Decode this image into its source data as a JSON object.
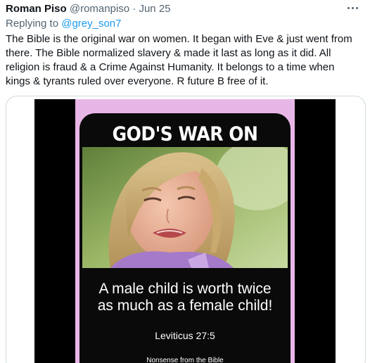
{
  "tweet": {
    "author_name": "Roman Piso",
    "author_handle": "@romanpiso",
    "separator": "·",
    "date": "Jun 25",
    "reply_prefix": "Replying to",
    "reply_to": "@grey_son7",
    "text": "The Bible is the original war on women. It began with Eve & just went from there. The Bible normalized slavery & made it last as long as it did. All religion is fraud & a Crime Against Humanity. It belongs to a time when kings & tyrants ruled over everyone. R future B free of it."
  },
  "media": {
    "title": "GOD'S WAR ON WOMEN",
    "caption_line1": "A male child is worth twice",
    "caption_line2": "as much as a female child!",
    "verse": "Leviticus 27:5",
    "source": "Nonsense from the Bible",
    "photo_icon": "crying-girl-photo"
  },
  "icons": {
    "more": "more-options-icon"
  },
  "colors": {
    "text_primary": "#0f1419",
    "text_secondary": "#536471",
    "link": "#1d9bf0",
    "card_border": "#cfd9de",
    "poster_pink": "#e8b6e6",
    "poster_black": "#0a0a0a"
  }
}
